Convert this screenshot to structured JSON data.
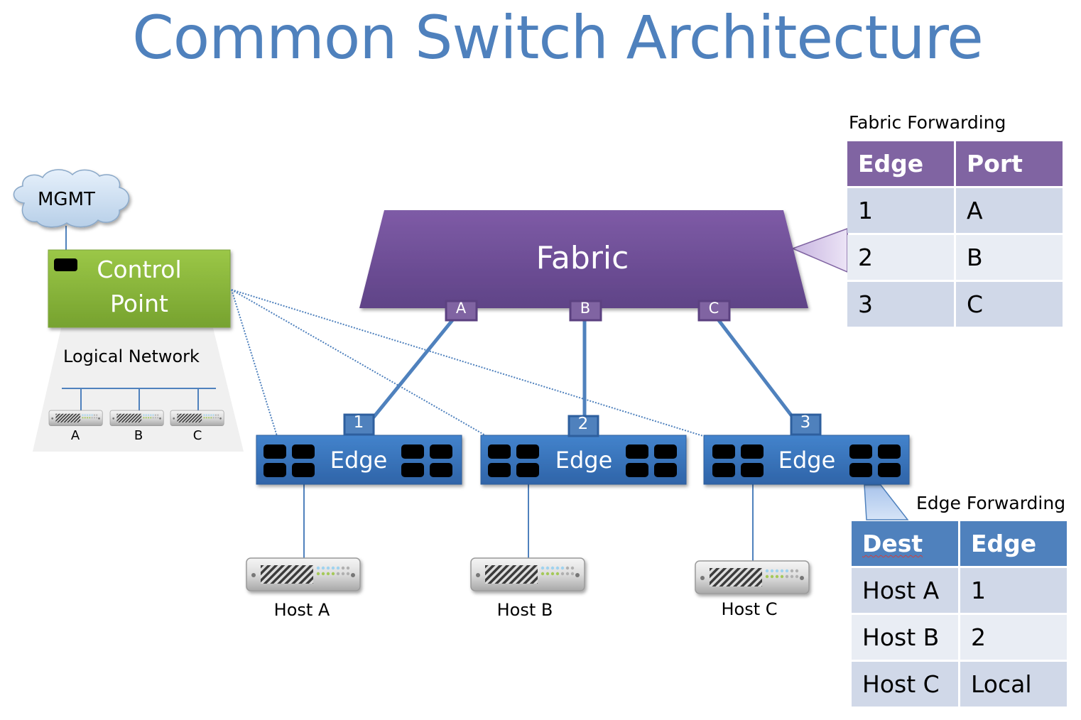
{
  "title": "Common Switch Architecture",
  "colors": {
    "title": "#4f81bd",
    "fabric": "#7a58a2",
    "edge": "#3d78c2",
    "control_point": "#8ab83a",
    "link": "#4f81bd"
  },
  "mgmt": {
    "label": "MGMT",
    "icon": "cloud-icon"
  },
  "control_point": {
    "line1": "Control",
    "line2": "Point"
  },
  "logical_network": {
    "label": "Logical Network",
    "hosts": [
      "A",
      "B",
      "C"
    ]
  },
  "fabric": {
    "label": "Fabric",
    "ports": [
      "A",
      "B",
      "C"
    ]
  },
  "edges": [
    {
      "label": "Edge",
      "port": "1",
      "host": "Host A"
    },
    {
      "label": "Edge",
      "port": "2",
      "host": "Host B"
    },
    {
      "label": "Edge",
      "port": "3",
      "host": "Host C"
    }
  ],
  "fabric_forwarding": {
    "caption": "Fabric Forwarding",
    "headers": [
      "Edge",
      "Port"
    ],
    "rows": [
      [
        "1",
        "A"
      ],
      [
        "2",
        "B"
      ],
      [
        "3",
        "C"
      ]
    ]
  },
  "edge_forwarding": {
    "caption": "Edge Forwarding",
    "headers": [
      "Dest",
      "Edge"
    ],
    "rows": [
      [
        "Host A",
        "1"
      ],
      [
        "Host B",
        "2"
      ],
      [
        "Host C",
        "Local"
      ]
    ]
  }
}
